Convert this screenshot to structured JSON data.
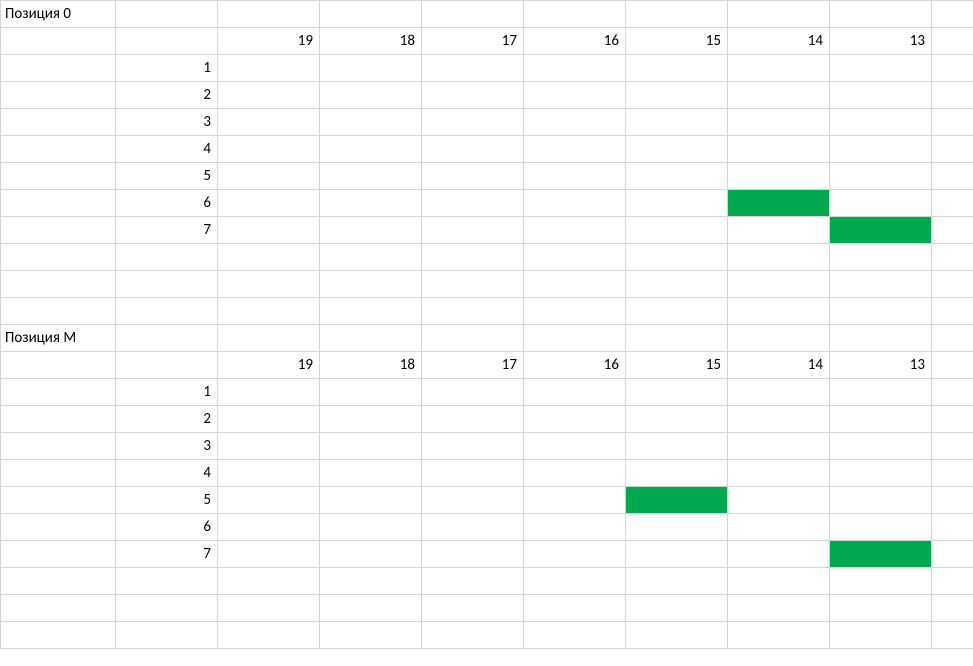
{
  "blocks": [
    {
      "title": "Позиция 0",
      "columns": [
        "19",
        "18",
        "17",
        "16",
        "15",
        "14",
        "13"
      ],
      "rows": [
        "1",
        "2",
        "3",
        "4",
        "5",
        "6",
        "7"
      ],
      "filled": [
        {
          "row": "6",
          "col": "14"
        },
        {
          "row": "7",
          "col": "13"
        }
      ]
    },
    {
      "title": "Позиция М",
      "columns": [
        "19",
        "18",
        "17",
        "16",
        "15",
        "14",
        "13"
      ],
      "rows": [
        "1",
        "2",
        "3",
        "4",
        "5",
        "6",
        "7"
      ],
      "filled": [
        {
          "row": "5",
          "col": "15"
        },
        {
          "row": "7",
          "col": "13"
        }
      ]
    }
  ]
}
